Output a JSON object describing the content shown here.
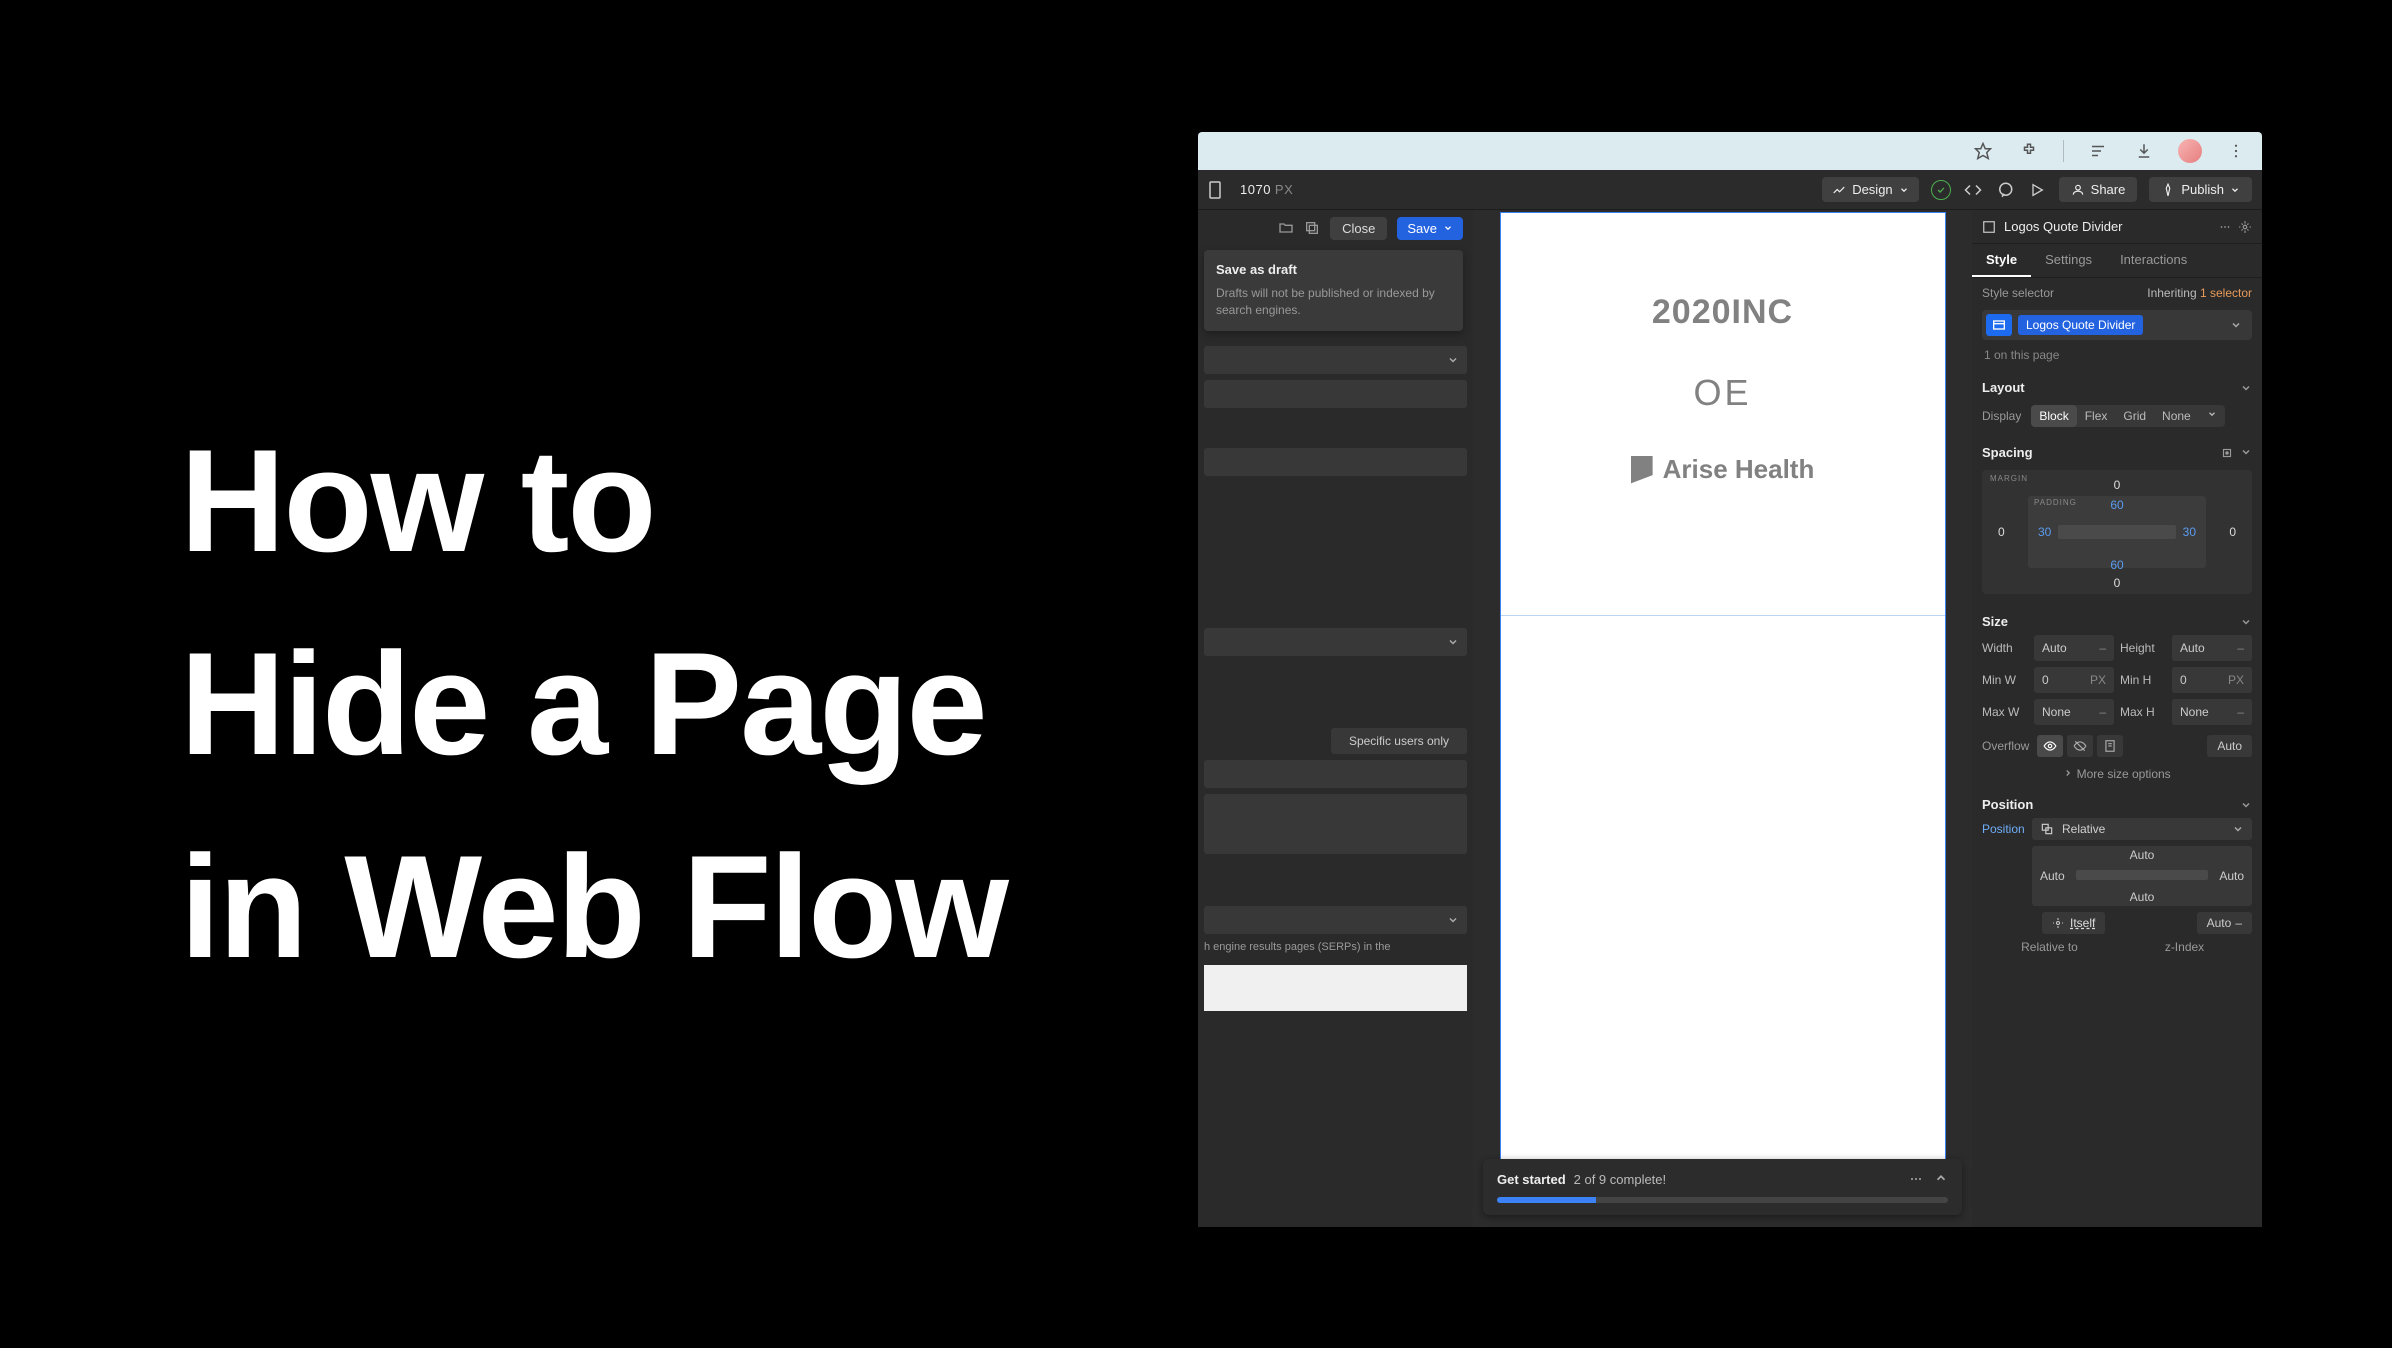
{
  "title": {
    "line1": "How to",
    "line2": "Hide a Page",
    "line3": "in Web Flow"
  },
  "browser": {
    "icons": [
      "star",
      "puzzle",
      "list",
      "download",
      "avatar",
      "menu"
    ]
  },
  "topbar": {
    "breakpoint_value": "1070",
    "breakpoint_unit": "PX",
    "design_label": "Design",
    "share_label": "Share",
    "publish_label": "Publish"
  },
  "page_panel": {
    "close_label": "Close",
    "save_label": "Save",
    "tooltip_title": "Save as draft",
    "tooltip_body": "Drafts will not be published or indexed by search engines.",
    "segment_label": "Specific users only",
    "serp_help": "h engine results pages (SERPs) in the"
  },
  "canvas": {
    "logo1": "2020INC",
    "logo2": "OE",
    "logo3": "Arise Health"
  },
  "get_started": {
    "title": "Get started",
    "progress_text": "2 of 9 complete!",
    "done": 2,
    "total": 9
  },
  "style_panel": {
    "element_name": "Logos Quote Divider",
    "tabs": {
      "style": "Style",
      "settings": "Settings",
      "interactions": "Interactions"
    },
    "selector_header": "Style selector",
    "inheriting_label": "Inheriting",
    "inheriting_count": "1 selector",
    "selector_tag": "Logos Quote Divider",
    "on_page": "1 on this page",
    "layout": {
      "header": "Layout",
      "display_label": "Display",
      "options": [
        "Block",
        "Flex",
        "Grid",
        "None"
      ],
      "active": "Block"
    },
    "spacing": {
      "header": "Spacing",
      "margin_label": "MARGIN",
      "padding_label": "PADDING",
      "margin": {
        "top": "0",
        "right": "0",
        "bottom": "0",
        "left": "0"
      },
      "padding": {
        "top": "60",
        "right": "30",
        "bottom": "60",
        "left": "30"
      }
    },
    "size": {
      "header": "Size",
      "width": {
        "label": "Width",
        "value": "Auto",
        "unit": "–"
      },
      "height": {
        "label": "Height",
        "value": "Auto",
        "unit": "–"
      },
      "minw": {
        "label": "Min W",
        "value": "0",
        "unit": "PX"
      },
      "minh": {
        "label": "Min H",
        "value": "0",
        "unit": "PX"
      },
      "maxw": {
        "label": "Max W",
        "value": "None",
        "unit": "–"
      },
      "maxh": {
        "label": "Max H",
        "value": "None",
        "unit": "–"
      },
      "overflow_label": "Overflow",
      "auto_label": "Auto",
      "more_label": "More size options"
    },
    "position": {
      "header": "Position",
      "label": "Position",
      "value": "Relative",
      "inset": {
        "top": "Auto",
        "right": "Auto",
        "bottom": "Auto",
        "left": "Auto"
      },
      "itself": "Itself",
      "auto": "Auto",
      "relative_to": "Relative to",
      "z_index": "z-Index"
    }
  }
}
